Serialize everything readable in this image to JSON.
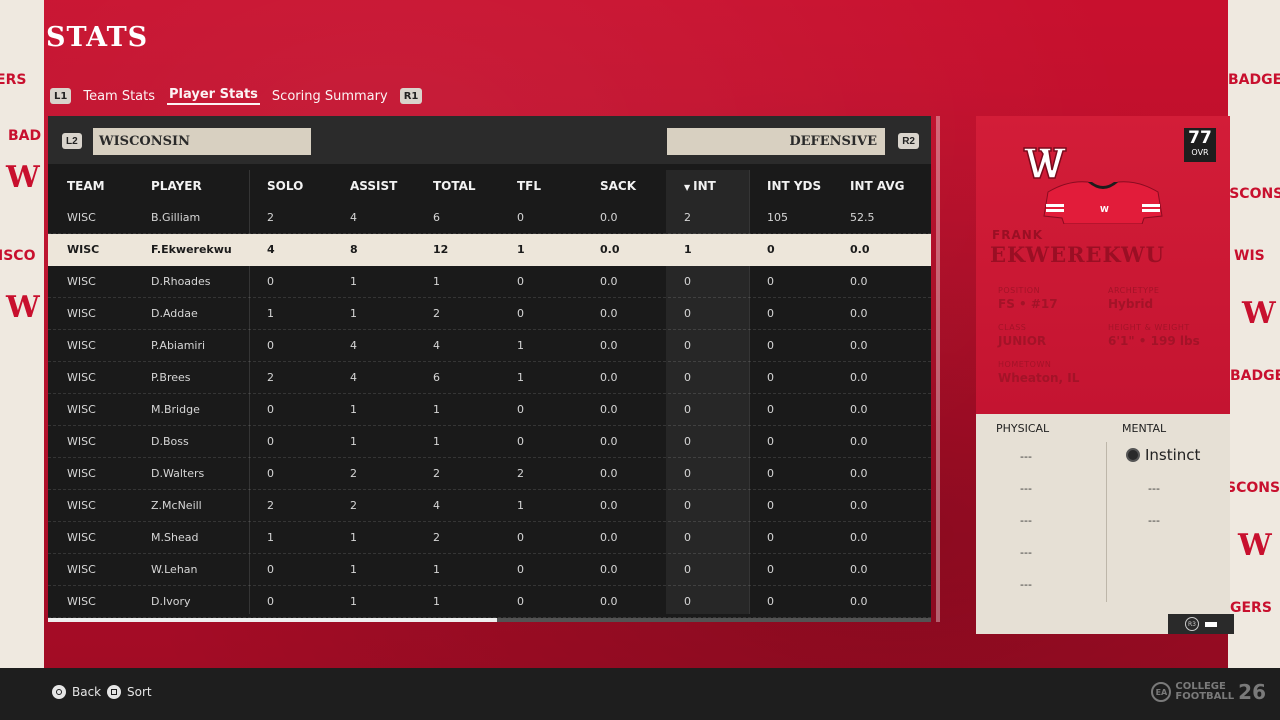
{
  "page": {
    "title": "STATS"
  },
  "tabs": {
    "left_button": "L1",
    "right_button": "R1",
    "items": [
      {
        "label": "Team Stats",
        "active": false
      },
      {
        "label": "Player Stats",
        "active": true
      },
      {
        "label": "Scoring Summary",
        "active": false
      }
    ]
  },
  "table": {
    "team_button": "L2",
    "team_name": "WISCONSIN",
    "type_button": "R2",
    "stat_type": "DEFENSIVE",
    "sorted_column": "INT",
    "columns": [
      "TEAM",
      "PLAYER",
      "SOLO",
      "ASSIST",
      "TOTAL",
      "TFL",
      "SACK",
      "INT",
      "INT YDS",
      "INT AVG"
    ],
    "selected_row": 1,
    "rows": [
      [
        "WISC",
        "B.Gilliam",
        "2",
        "4",
        "6",
        "0",
        "0.0",
        "2",
        "105",
        "52.5"
      ],
      [
        "WISC",
        "F.Ekwerekwu",
        "4",
        "8",
        "12",
        "1",
        "0.0",
        "1",
        "0",
        "0.0"
      ],
      [
        "WISC",
        "D.Rhoades",
        "0",
        "1",
        "1",
        "0",
        "0.0",
        "0",
        "0",
        "0.0"
      ],
      [
        "WISC",
        "D.Addae",
        "1",
        "1",
        "2",
        "0",
        "0.0",
        "0",
        "0",
        "0.0"
      ],
      [
        "WISC",
        "P.Abiamiri",
        "0",
        "4",
        "4",
        "1",
        "0.0",
        "0",
        "0",
        "0.0"
      ],
      [
        "WISC",
        "P.Brees",
        "2",
        "4",
        "6",
        "1",
        "0.0",
        "0",
        "0",
        "0.0"
      ],
      [
        "WISC",
        "M.Bridge",
        "0",
        "1",
        "1",
        "0",
        "0.0",
        "0",
        "0",
        "0.0"
      ],
      [
        "WISC",
        "D.Boss",
        "0",
        "1",
        "1",
        "0",
        "0.0",
        "0",
        "0",
        "0.0"
      ],
      [
        "WISC",
        "D.Walters",
        "0",
        "2",
        "2",
        "2",
        "0.0",
        "0",
        "0",
        "0.0"
      ],
      [
        "WISC",
        "Z.McNeill",
        "2",
        "2",
        "4",
        "1",
        "0.0",
        "0",
        "0",
        "0.0"
      ],
      [
        "WISC",
        "M.Shead",
        "1",
        "1",
        "2",
        "0",
        "0.0",
        "0",
        "0",
        "0.0"
      ],
      [
        "WISC",
        "W.Lehan",
        "0",
        "1",
        "1",
        "0",
        "0.0",
        "0",
        "0",
        "0.0"
      ],
      [
        "WISC",
        "D.Ivory",
        "0",
        "1",
        "1",
        "0",
        "0.0",
        "0",
        "0",
        "0.0"
      ]
    ]
  },
  "player_card": {
    "ovr": "77",
    "ovr_label": "OVR",
    "logo_icon": "wisconsin-w-logo-icon",
    "first_name": "FRANK",
    "last_name": "EKWEREKWU",
    "position_label": "POSITION",
    "position": "FS • #17",
    "archetype_label": "ARCHETYPE",
    "archetype": "Hybrid",
    "class_label": "CLASS",
    "class": "JUNIOR",
    "height_weight_label": "HEIGHT & WEIGHT",
    "height_weight": "6'1\" • 199 lbs",
    "hometown_label": "HOMETOWN",
    "hometown": "Wheaton, IL",
    "physical_label": "PHYSICAL",
    "mental_label": "MENTAL",
    "physical_abilities": [
      "---",
      "---",
      "---",
      "---",
      "---"
    ],
    "mental_ability": "Instinct",
    "mental_abilities": [
      "---",
      "---"
    ],
    "r3_button": "R3"
  },
  "background": {
    "left_words": [
      "ERS",
      "BAD",
      "ISCO"
    ],
    "right_words": [
      "BADGER",
      "ISCONSIN",
      "WIS",
      "BADGE",
      "SCONSI",
      "GERS"
    ]
  },
  "footer": {
    "back_label": "Back",
    "sort_label": "Sort",
    "brand_ea": "EA",
    "brand_line1": "COLLEGE",
    "brand_line2": "FOOTBALL",
    "brand_num": "26"
  },
  "colors": {
    "brand_red": "#c8102e",
    "cream": "#e6e0d5",
    "panel_dark": "#1a1a1a"
  }
}
